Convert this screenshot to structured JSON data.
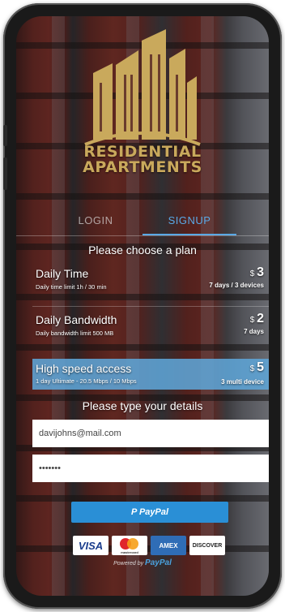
{
  "brand": {
    "line1": "RESIDENTIAL",
    "line2": "APARTMENTS"
  },
  "tabs": [
    {
      "label": "LOGIN",
      "active": false
    },
    {
      "label": "SIGNUP",
      "active": true
    }
  ],
  "plans_heading": "Please choose a plan",
  "plans": [
    {
      "name": "Daily Time",
      "description": "Daily time limit 1h / 30 min",
      "currency": "$",
      "price": "3",
      "terms": "7 days / 3 devices",
      "selected": false
    },
    {
      "name": "Daily Bandwidth",
      "description": "Daily bandwidth limit 500 MB",
      "currency": "$",
      "price": "2",
      "terms": "7 days",
      "selected": false
    },
    {
      "name": "High speed access",
      "description": "1 day Ultimate - 20.5 Mbps / 10 Mbps",
      "currency": "$",
      "price": "5",
      "terms": "3 multi device",
      "selected": true
    }
  ],
  "details_heading": "Please type your details",
  "email_field": {
    "value": "davijohns@mail.com"
  },
  "password_field": {
    "value": "•••••••"
  },
  "paypal_button": {
    "label": "P PayPal"
  },
  "cards": {
    "visa": "VISA",
    "mastercard": "mastercard",
    "amex": "AMEX",
    "discover": "DISCOVER"
  },
  "powered_by": {
    "prefix": "Powered by",
    "brand": "PayPal"
  },
  "colors": {
    "accent": "#5aa9e6",
    "gold": "#c9a95c",
    "selected_plan": "#5fa5d7",
    "paypal": "#2a8fd6"
  }
}
